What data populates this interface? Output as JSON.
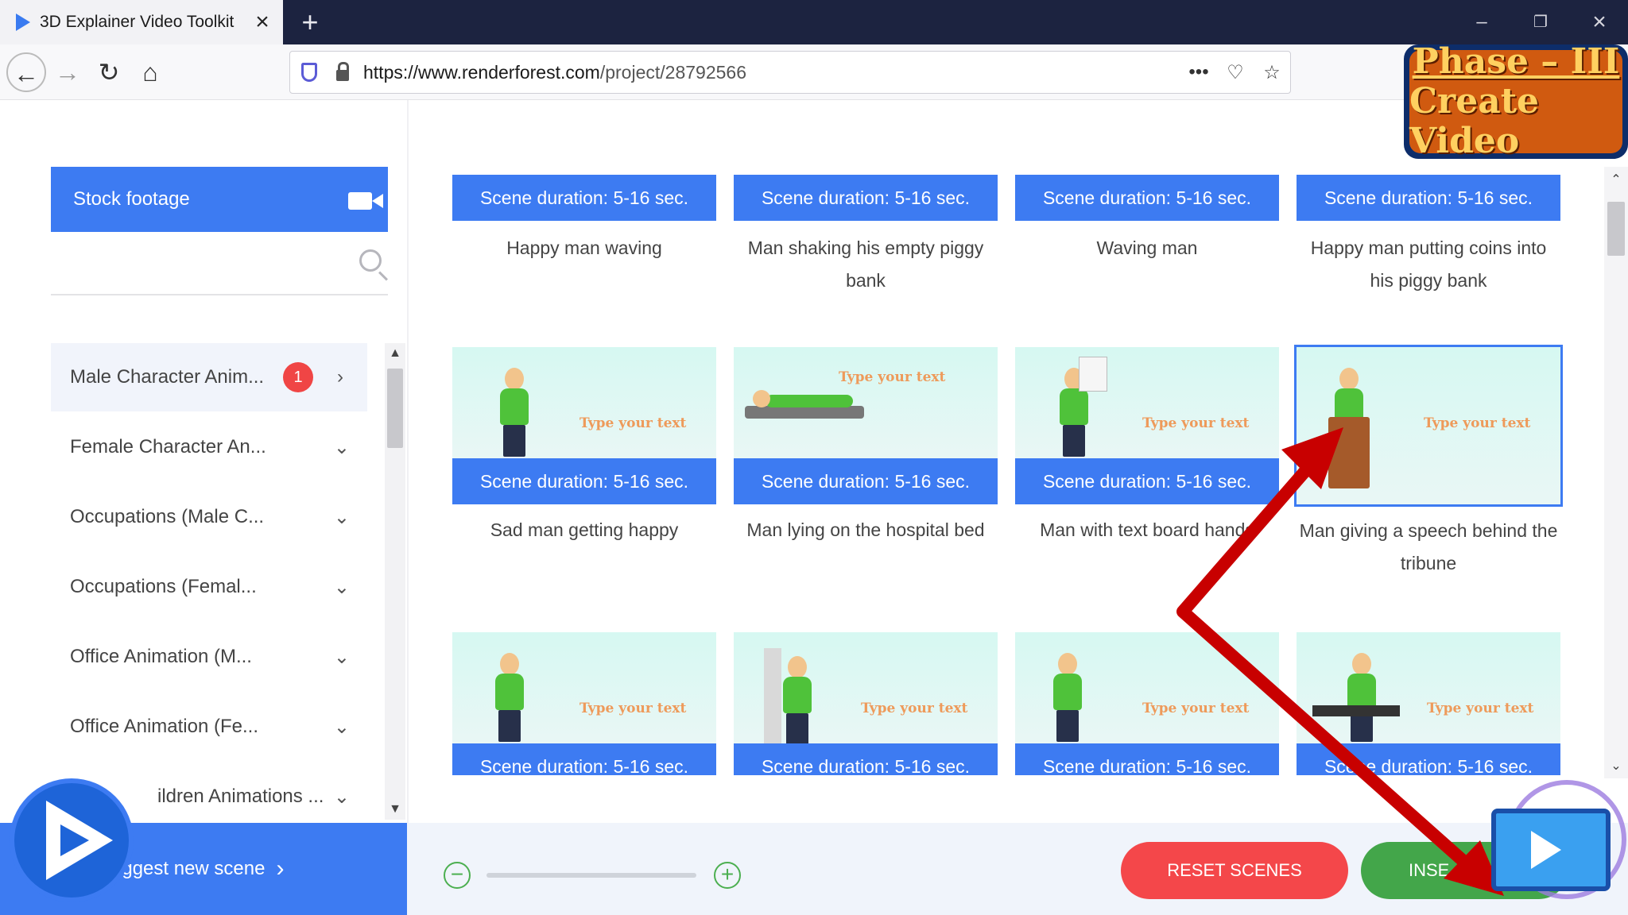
{
  "browser": {
    "tab_title": "3D Explainer Video Toolkit",
    "url_domain": "https://www.renderforest.com",
    "url_path": "/project/28792566"
  },
  "badge": {
    "line1": "Phase – III",
    "line2": "Create Video"
  },
  "sidebar": {
    "stock_label": "Stock footage",
    "search_placeholder": "",
    "categories": [
      {
        "label": "Male Character Anim...",
        "badge": "1"
      },
      {
        "label": "Female Character An..."
      },
      {
        "label": "Occupations (Male C..."
      },
      {
        "label": "Occupations (Femal..."
      },
      {
        "label": "Office Animation (M..."
      },
      {
        "label": "Office Animation (Fe..."
      },
      {
        "label": "ildren Animations ..."
      }
    ],
    "suggest_label": "uggest new scene"
  },
  "scenes": {
    "duration_label": "Scene duration: 5-16 sec.",
    "placeholder_text": "Type your text",
    "row1": [
      "Happy man waving",
      "Man shaking his empty piggy bank",
      "Waving man",
      "Happy man putting coins into his piggy bank"
    ],
    "row2": [
      "Sad man getting happy",
      "Man lying on the hospital bed",
      "Man with text board hands",
      "Man giving a speech behind the tribune"
    ]
  },
  "bottom": {
    "reset_label": "RESET SCENES",
    "insert_label": "INSE"
  },
  "colors": {
    "primary": "#3d7bf2",
    "reset": "#f4474a",
    "insert": "#43a64a",
    "arrow": "#c80000"
  }
}
